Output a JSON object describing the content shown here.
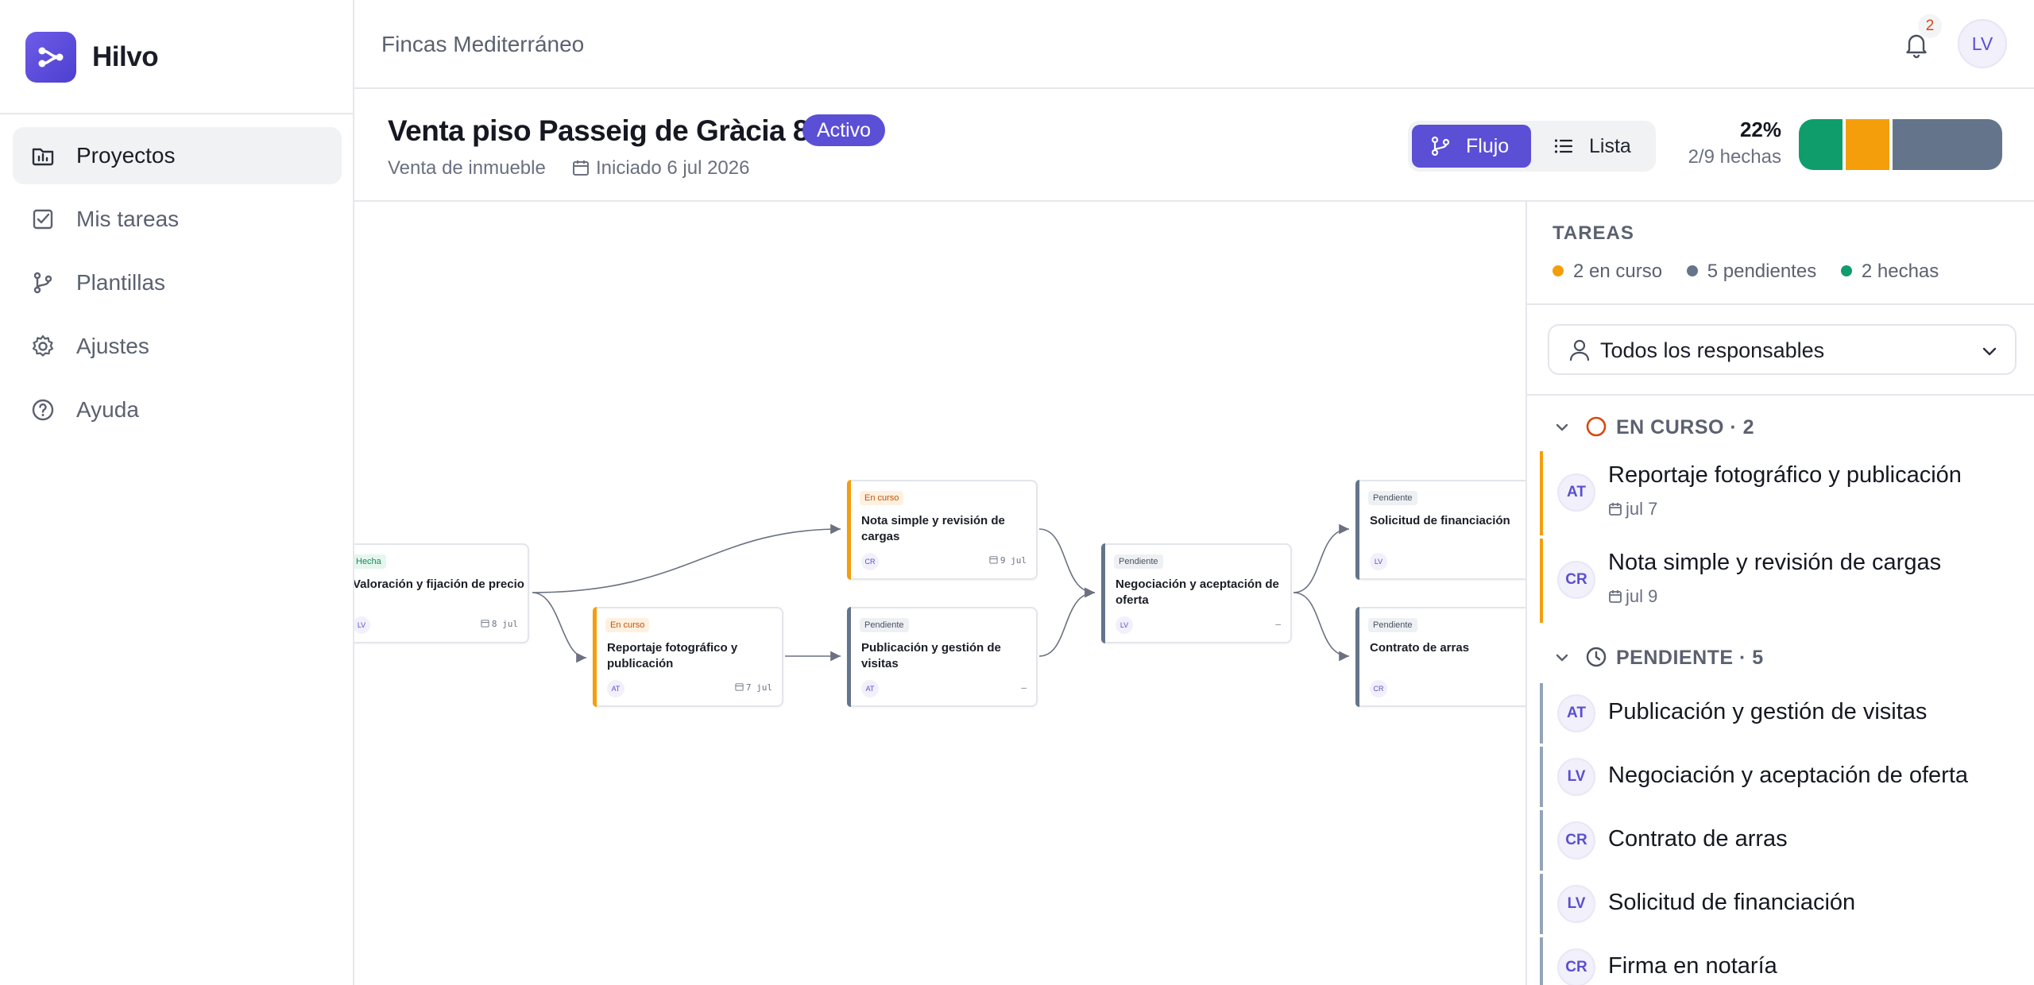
{
  "brand": {
    "name": "Hilvo"
  },
  "sidebar": {
    "items": [
      {
        "label": "Proyectos",
        "icon": "folder-chart-icon",
        "active": true
      },
      {
        "label": "Mis tareas",
        "icon": "checkbox-icon",
        "active": false
      },
      {
        "label": "Plantillas",
        "icon": "git-branch-icon",
        "active": false
      },
      {
        "label": "Ajustes",
        "icon": "gear-icon",
        "active": false
      },
      {
        "label": "Ayuda",
        "icon": "help-circle-icon",
        "active": false
      }
    ]
  },
  "topbar": {
    "org_name": "Fincas Mediterráneo",
    "notification_count": "2",
    "user_initials": "LV"
  },
  "project": {
    "title": "Venta piso Passeig de Gràcia 8",
    "status": "Activo",
    "type": "Venta de inmueble",
    "started": "Iniciado 6 jul 2026",
    "view_flow_label": "Flujo",
    "view_list_label": "Lista",
    "progress_pct": "22%",
    "progress_done": "2/9 hechas",
    "progress_fractions": {
      "done": 0.22,
      "in_progress": 0.22,
      "pending": 0.56
    }
  },
  "colors": {
    "accent": "#5b4fd6",
    "done": "#0f9d6b",
    "in_progress": "#f59e0b",
    "pending": "#64748b"
  },
  "flow": {
    "nodes": [
      {
        "id": "n1",
        "status": "Hecha",
        "kind": "done",
        "title": "Valoración y fijación de precio",
        "assignee": "LV",
        "date": "8 jul"
      },
      {
        "id": "n2",
        "status": "En curso",
        "kind": "prog",
        "title": "Reportaje fotográfico y publicación",
        "assignee": "AT",
        "date": "7 jul"
      },
      {
        "id": "n3",
        "status": "En curso",
        "kind": "prog",
        "title": "Nota simple y revisión de cargas",
        "assignee": "CR",
        "date": "9 jul"
      },
      {
        "id": "n4",
        "status": "Pendiente",
        "kind": "pend",
        "title": "Publicación y gestión de visitas",
        "assignee": "AT",
        "date": "—"
      },
      {
        "id": "n5",
        "status": "Pendiente",
        "kind": "pend",
        "title": "Negociación y aceptación de oferta",
        "assignee": "LV",
        "date": "—"
      },
      {
        "id": "n6",
        "status": "Pendiente",
        "kind": "pend",
        "title": "Solicitud de financiación",
        "assignee": "LV",
        "date": ""
      },
      {
        "id": "n7",
        "status": "Pendiente",
        "kind": "pend",
        "title": "Contrato de arras",
        "assignee": "CR",
        "date": ""
      }
    ]
  },
  "panel": {
    "title": "TAREAS",
    "stats": [
      {
        "label": "2 en curso",
        "color": "#f59e0b"
      },
      {
        "label": "5 pendientes",
        "color": "#64748b"
      },
      {
        "label": "2 hechas",
        "color": "#0f9d6b"
      }
    ],
    "filter_label": "Todos los responsables",
    "groups": {
      "in_progress": {
        "label": "EN CURSO · 2",
        "tasks": [
          {
            "initials": "AT",
            "title": "Reportaje fotográfico y publicación",
            "date": "jul 7"
          },
          {
            "initials": "CR",
            "title": "Nota simple y revisión de cargas",
            "date": "jul 9"
          }
        ]
      },
      "pending": {
        "label": "PENDIENTE · 5",
        "tasks": [
          {
            "initials": "AT",
            "title": "Publicación y gestión de visitas"
          },
          {
            "initials": "LV",
            "title": "Negociación y aceptación de oferta"
          },
          {
            "initials": "CR",
            "title": "Contrato de arras"
          },
          {
            "initials": "LV",
            "title": "Solicitud de financiación"
          },
          {
            "initials": "CR",
            "title": "Firma en notaría"
          }
        ]
      }
    }
  }
}
